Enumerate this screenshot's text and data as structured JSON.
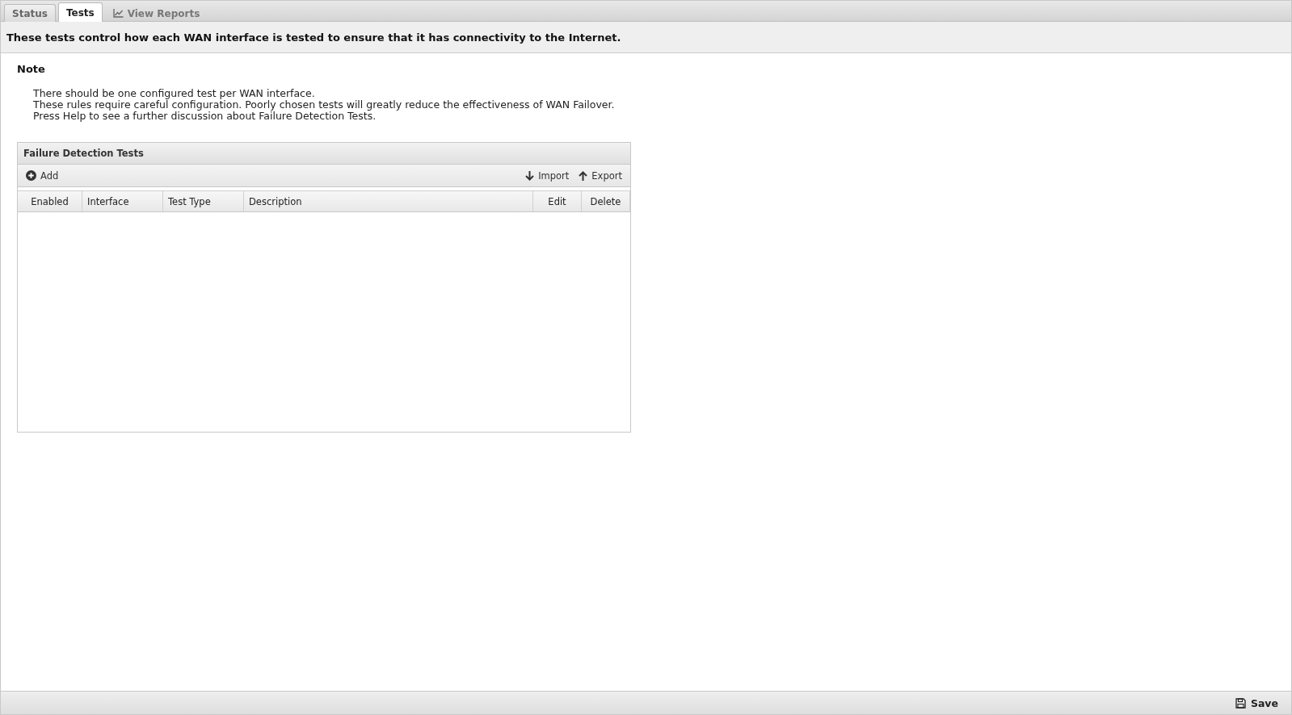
{
  "tabs": [
    {
      "label": "Status",
      "kind": "plain",
      "selected": false
    },
    {
      "label": "Tests",
      "kind": "plain",
      "selected": true
    },
    {
      "label": "View Reports",
      "kind": "chart",
      "selected": false
    }
  ],
  "intro": "These tests control how each WAN interface is tested to ensure that it has connectivity to the Internet.",
  "note": {
    "title": "Note",
    "lines": [
      "There should be one configured test per WAN interface.",
      "These rules require careful configuration. Poorly chosen tests will greatly reduce the effectiveness of WAN Failover.",
      "Press Help to see a further discussion about Failure Detection Tests."
    ]
  },
  "panel": {
    "title": "Failure Detection Tests",
    "toolbar": [
      {
        "label": "Add",
        "kind": "add"
      },
      {
        "label": "Import",
        "kind": "import"
      },
      {
        "label": "Export",
        "kind": "export"
      }
    ],
    "columns": [
      "Enabled",
      "Interface",
      "Test Type",
      "Description",
      "Edit",
      "Delete"
    ]
  },
  "footer": {
    "save": "Save"
  }
}
